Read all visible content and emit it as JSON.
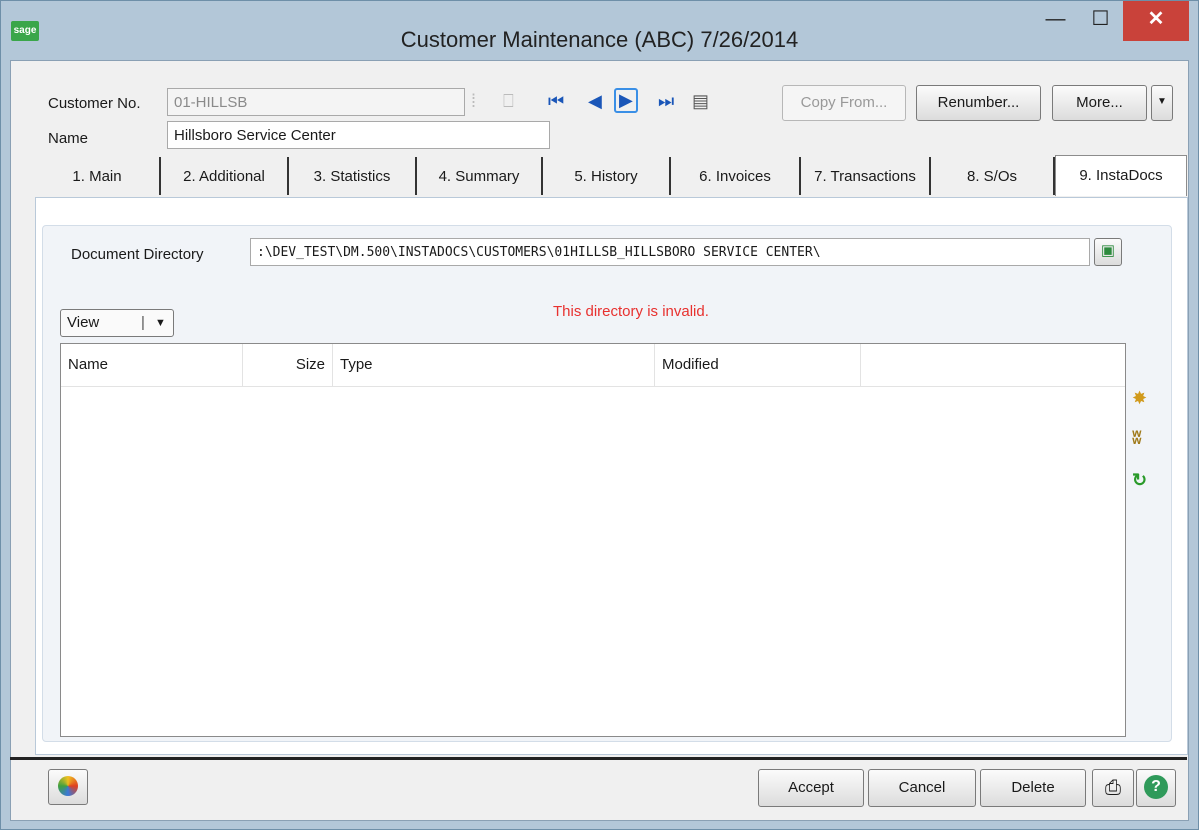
{
  "window": {
    "app_logo": "sage",
    "title": "Customer Maintenance (ABC) 7/26/2014",
    "min_icon": "minimize-icon",
    "max_icon": "maximize-icon",
    "close_icon": "close-icon"
  },
  "header": {
    "customer_no_label": "Customer No.",
    "customer_no_value": "01-HILLSB",
    "name_label": "Name",
    "name_value": "Hillsboro Service Center",
    "nav_icons": [
      "lookup-icon",
      "new-icon",
      "first-record-icon",
      "previous-record-icon",
      "next-record-icon",
      "last-record-icon",
      "calendar-icon"
    ],
    "copy_from": "Copy From...",
    "renumber": "Renumber...",
    "more": "More..."
  },
  "tabs": [
    {
      "label": "1. Main"
    },
    {
      "label": "2. Additional"
    },
    {
      "label": "3. Statistics"
    },
    {
      "label": "4. Summary"
    },
    {
      "label": "5. History"
    },
    {
      "label": "6. Invoices"
    },
    {
      "label": "7. Transactions"
    },
    {
      "label": "8. S/Os"
    },
    {
      "label": "9. InstaDocs"
    }
  ],
  "instadocs": {
    "doc_dir_label": "Document Directory",
    "doc_dir_value": ":\\DEV_TEST\\DM.500\\INSTADOCS\\CUSTOMERS\\01HILLSB_HILLSBORO SERVICE CENTER\\",
    "view_label": "View",
    "error_text": "This directory is invalid.",
    "error_color": "#e8312f",
    "columns": [
      "Name",
      "Size",
      "Type",
      "Modified"
    ],
    "side_icons": [
      "wand-icon",
      "binoculars-icon",
      "refresh-icon"
    ]
  },
  "footer": {
    "accept": "Accept",
    "cancel": "Cancel",
    "delete": "Delete",
    "left_icon": "color-wheel-icon",
    "print_icon": "printer-icon",
    "help_icon": "help-icon"
  }
}
